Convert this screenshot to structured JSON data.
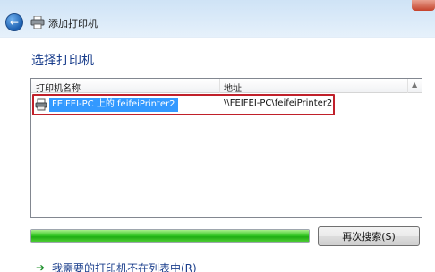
{
  "window": {
    "title": "添加打印机"
  },
  "main": {
    "heading": "选择打印机",
    "list": {
      "columns": [
        "打印机名称",
        "地址"
      ],
      "rows": [
        {
          "name": "FEIFEI-PC 上的 feifeiPrinter2",
          "address": "\\\\FEIFEI-PC\\feifeiPrinter2",
          "selected": true
        }
      ]
    },
    "progress": {
      "fraction": 1.0
    },
    "search_again_label": "再次搜索(S)",
    "not_listed_link": "我需要的打印机不在列表中(R)"
  },
  "colors": {
    "selection": "#3399ff",
    "highlight_box": "#c0202a",
    "progress": "#34c624",
    "heading": "#1a3e8c"
  },
  "icons": [
    "back-arrow-icon",
    "printer-icon",
    "close-icon",
    "green-arrow-icon"
  ]
}
